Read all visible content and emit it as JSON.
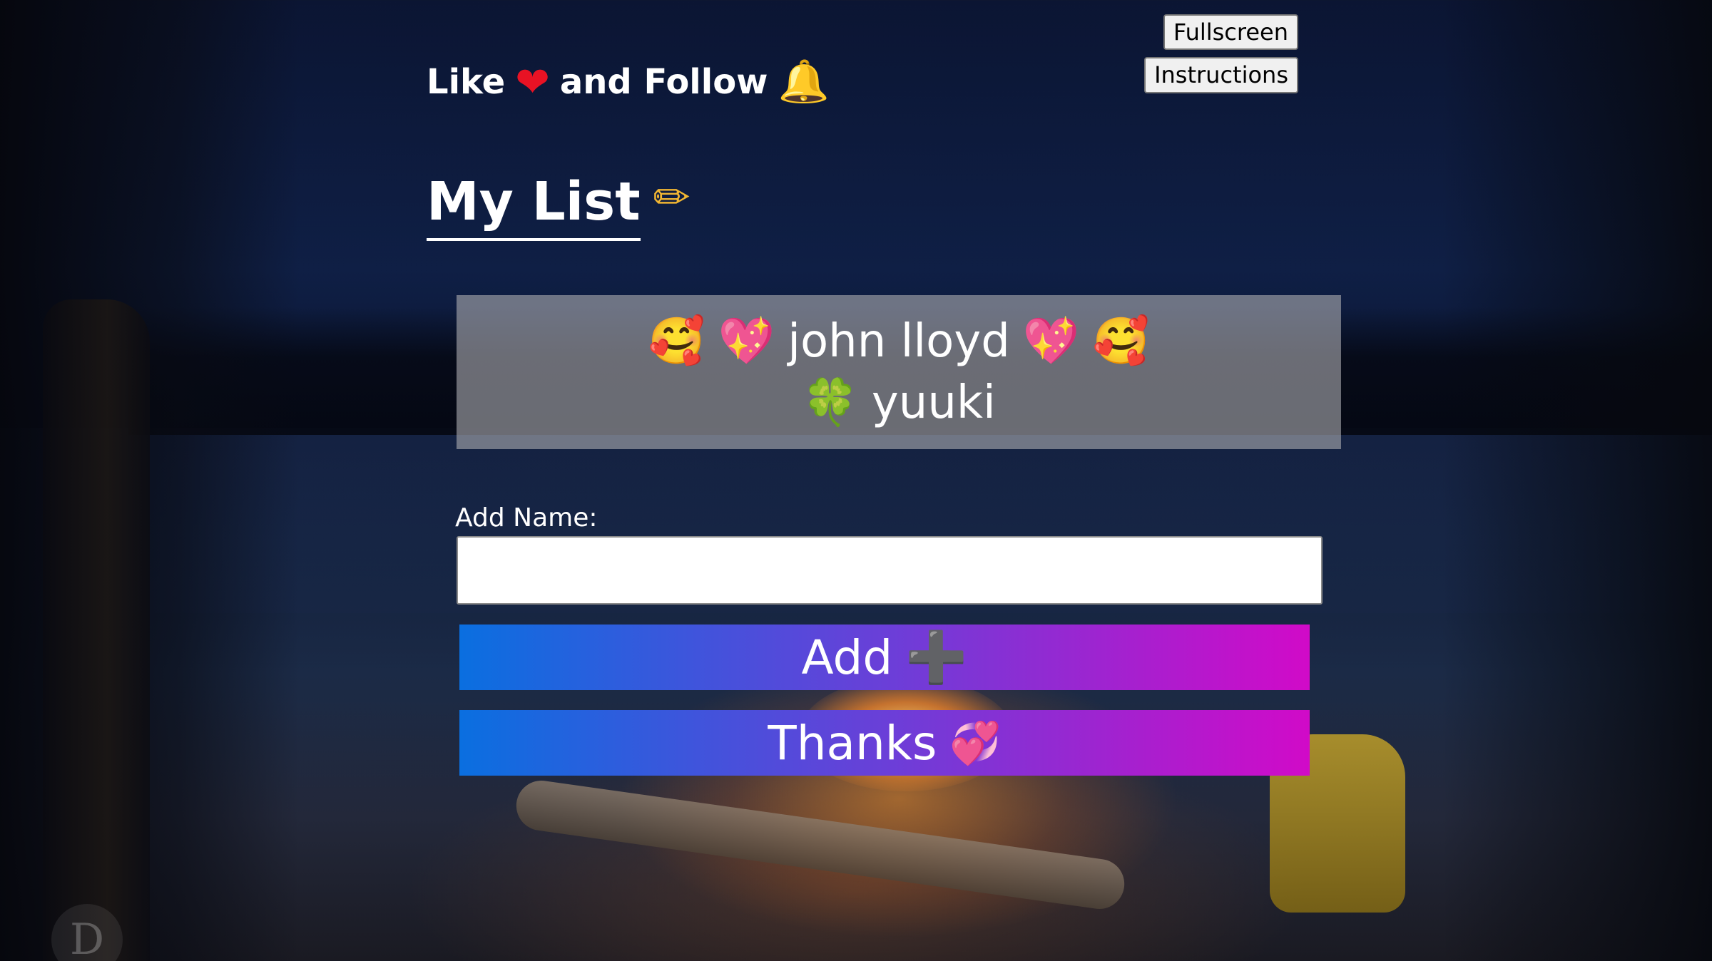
{
  "header": {
    "like_text": "Like",
    "heart_glyph": "❤",
    "follow_text": "and Follow",
    "bell_glyph": "🔔"
  },
  "top_buttons": {
    "fullscreen_label": "Fullscreen",
    "instructions_label": "Instructions"
  },
  "title": {
    "text": "My List",
    "pencil_glyph": "✏"
  },
  "list": {
    "items": [
      {
        "prefix_glyphs": [
          "🥰",
          "💖"
        ],
        "name": "john lloyd",
        "suffix_glyphs": [
          "💖",
          "🥰"
        ]
      },
      {
        "prefix_glyphs": [
          "🍀"
        ],
        "name": "yuuki",
        "suffix_glyphs": []
      }
    ]
  },
  "form": {
    "label": "Add Name:",
    "input_value": "",
    "add_label": "Add",
    "add_glyph": "➕",
    "thanks_label": "Thanks",
    "thanks_glyph": "💞"
  },
  "colors": {
    "button_gradient_start": "#0a6fe0",
    "button_gradient_end": "#d10ac8",
    "list_box_bg": "#aaaaaf"
  },
  "icons": [
    "heart-icon",
    "bell-icon",
    "pencil-icon",
    "smiling-hearts-icon",
    "sparkling-heart-icon",
    "clover-icon",
    "plus-icon",
    "revolving-hearts-icon"
  ]
}
